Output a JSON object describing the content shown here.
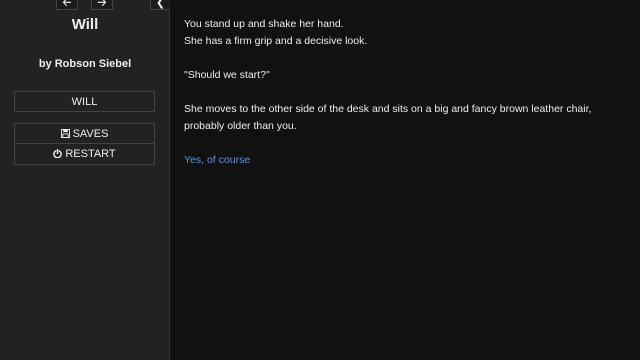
{
  "ui_bar": {
    "back_icon": "arrow-left-icon",
    "forward_icon": "arrow-right-icon",
    "stow_icon": "chevron-left-icon",
    "story_title": "Will",
    "story_author": "by Robson Siebel",
    "story_menu": [
      "WILL"
    ],
    "core_menu": [
      {
        "label": "SAVES",
        "icon": "floppy-disk-icon"
      },
      {
        "label": "RESTART",
        "icon": "power-icon"
      }
    ]
  },
  "passage": {
    "lines": [
      "You stand up and shake her hand.",
      "She has a firm grip and a decisive look.",
      "\"Should we start?\"",
      "She moves to the other side of the desk and sits on a big and fancy brown leather chair, probably older than you."
    ],
    "link": "Yes, of course"
  },
  "colors": {
    "background": "#111111",
    "sidebar": "#222222",
    "text": "#eeeeee",
    "link": "#6a8fd8"
  }
}
